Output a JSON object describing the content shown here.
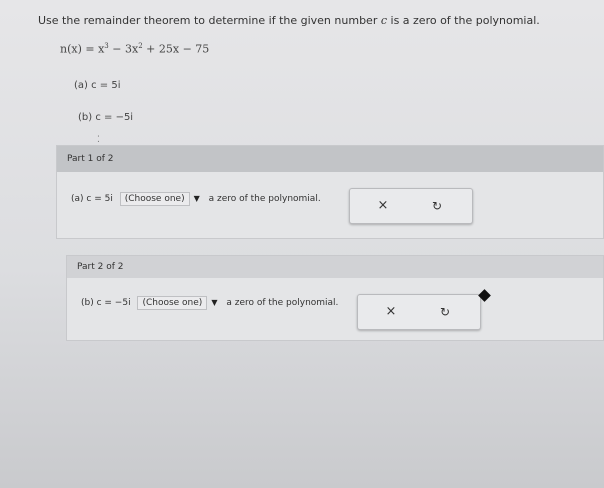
{
  "question": {
    "prefix": "Use the remainder theorem to determine if the given number ",
    "var": "c",
    "suffix": " is a zero of the polynomial."
  },
  "polynomial": {
    "lhs": "n(x) = x",
    "exp1": "3",
    "mid": " − 3x",
    "exp2": "2",
    "rest": " + 25x − 75"
  },
  "subparts": {
    "a": "(a) c = 5i",
    "b": "(b) c = −5i"
  },
  "part1": {
    "title": "Part 1 of 2",
    "prompt": "(a) c = 5i",
    "select_value": "(Choose one)",
    "tail": "a zero of the polynomial.",
    "clear_icon": "×",
    "undo_icon": "↻"
  },
  "part2": {
    "title": "Part 2 of 2",
    "prompt": "(b) c = −5i",
    "select_value": "(Choose one)",
    "tail": "a zero of the polynomial.",
    "clear_icon": "×",
    "undo_icon": "↻"
  }
}
